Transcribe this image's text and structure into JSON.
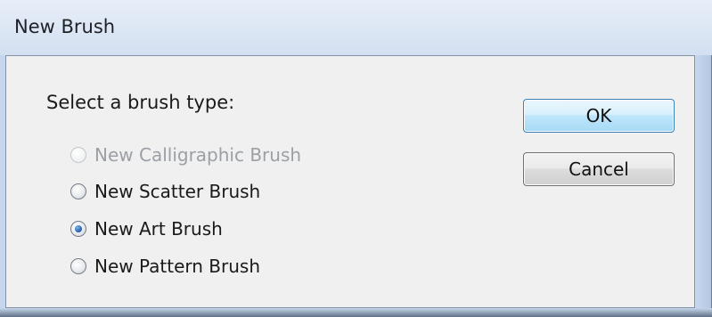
{
  "window": {
    "title": "New Brush"
  },
  "dialog": {
    "prompt": "Select a brush type:",
    "options": [
      {
        "label": "New Calligraphic Brush",
        "enabled": false,
        "selected": false
      },
      {
        "label": "New Scatter Brush",
        "enabled": true,
        "selected": false
      },
      {
        "label": "New Art Brush",
        "enabled": true,
        "selected": true
      },
      {
        "label": "New Pattern Brush",
        "enabled": true,
        "selected": false
      }
    ],
    "ok_label": "OK",
    "cancel_label": "Cancel"
  },
  "colors": {
    "ok_border": "#3c7fb1",
    "radio_selected": "#1f5ca8",
    "disabled_text": "#9aa0a6"
  }
}
